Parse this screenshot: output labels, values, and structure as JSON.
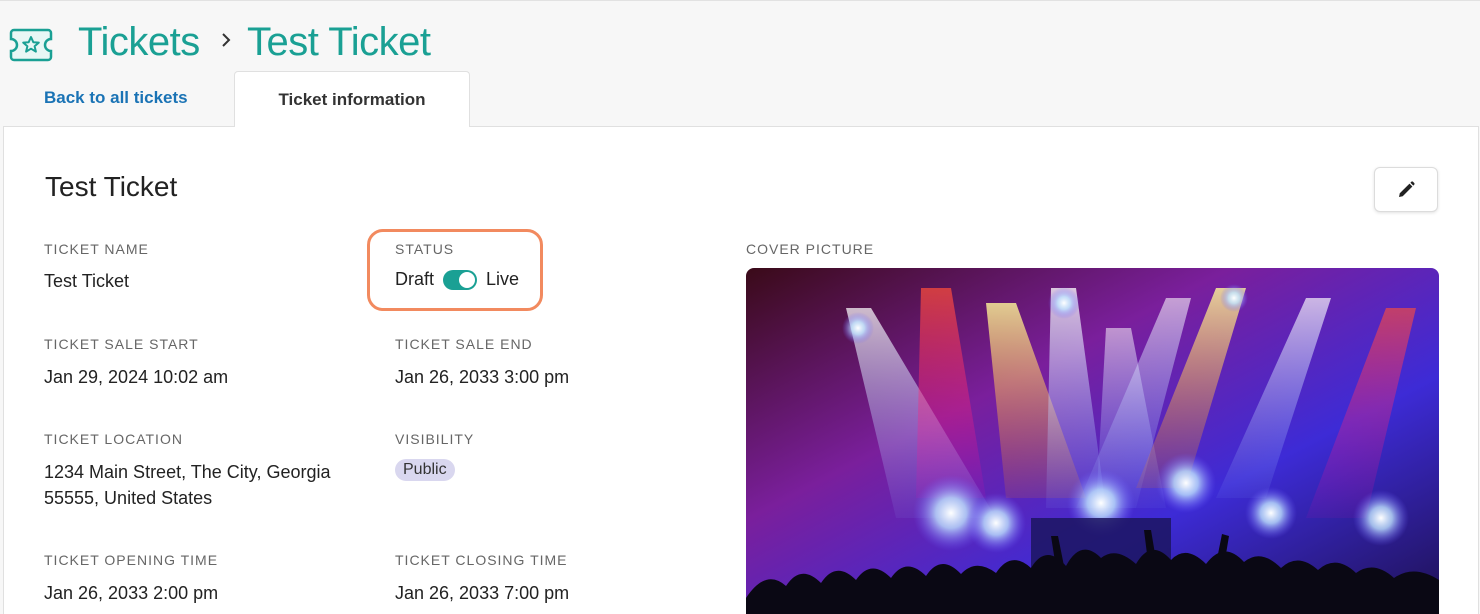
{
  "header": {
    "root_crumb": "Tickets",
    "current_crumb": "Test Ticket"
  },
  "tabs": {
    "back_label": "Back to all tickets",
    "active_label": "Ticket information"
  },
  "card": {
    "title": "Test Ticket",
    "fields": {
      "ticket_name": {
        "label": "TICKET NAME",
        "value": "Test Ticket"
      },
      "status": {
        "label": "STATUS",
        "off_label": "Draft",
        "on_label": "Live",
        "is_live": true
      },
      "sale_start": {
        "label": "TICKET SALE START",
        "value": "Jan 29, 2024 10:02 am"
      },
      "sale_end": {
        "label": "TICKET SALE END",
        "value": "Jan 26, 2033 3:00 pm"
      },
      "location": {
        "label": "TICKET LOCATION",
        "value": "1234 Main Street, The City, Georgia 55555, United States"
      },
      "visibility": {
        "label": "VISIBILITY",
        "value": "Public"
      },
      "opening_time": {
        "label": "TICKET OPENING TIME",
        "value": "Jan 26, 2033 2:00 pm"
      },
      "closing_time": {
        "label": "TICKET CLOSING TIME",
        "value": "Jan 26, 2033 7:00 pm"
      },
      "cover": {
        "label": "COVER PICTURE"
      }
    }
  },
  "icons": {
    "logo": "ticket-star-icon",
    "separator": "chevron-right-icon",
    "edit": "pencil-icon"
  },
  "colors": {
    "brand_teal": "#1aa094",
    "link_blue": "#1a73b5",
    "highlight_orange": "#f28a5f",
    "badge_bg": "#d9d7ef"
  }
}
